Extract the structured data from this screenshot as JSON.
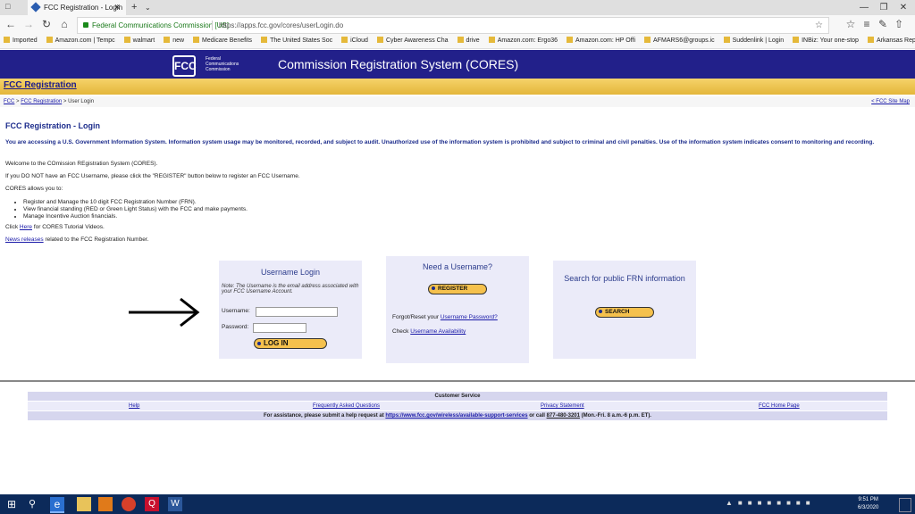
{
  "browser": {
    "tab_title": "FCC Registration - Login",
    "site_identity": "Federal Communications Commission [US]",
    "url": "https://apps.fcc.gov/cores/userLogin.do",
    "bookmarks": [
      "Imported",
      "Amazon.com | Tempc",
      "walmart",
      "new",
      "Medicare Benefits",
      "The United States Soc",
      "iCloud",
      "Cyber Awareness Cha",
      "drive",
      "Amazon.com: Ergo36",
      "Amazon.com: HP Offi",
      "AFMARS6@groups.ic",
      "Suddenlink | Login",
      "INBiz: Your one-stop",
      "Arkansas Repeater Co"
    ]
  },
  "header": {
    "logo_text": "FCC",
    "logo_subtitle": "Federal Communications Commission",
    "system_title": "Commission Registration System (CORES)",
    "registration_link": "FCC Registration",
    "breadcrumb": {
      "fcc": "FCC",
      "sep1": ">",
      "reg": "FCC Registration",
      "sep2": ">",
      "current": "User Login"
    },
    "site_map": "< FCC Site Map"
  },
  "content": {
    "title": "FCC Registration - Login",
    "warning": "You are accessing a U.S. Government Information System. Information system usage may be monitored, recorded, and subject to audit. Unauthorized use of the information system is prohibited and subject to criminal and civil penalties. Use of the information system indicates consent to monitoring and recording.",
    "welcome": "Welcome to the COmission REgistration System (CORES).",
    "no_username": "If you DO NOT have an FCC Username, please click the \"REGISTER\" button below to register an FCC Username.",
    "allows": "CORES allows you to:",
    "list": [
      "Register and Manage the 10 digit FCC Registration Number (FRN).",
      "View financial standing (RED or Green Light Status) with the FCC and make payments.",
      "Manage Incentive Auction financials."
    ],
    "tutorial_prefix": "Click",
    "tutorial_link": "Here",
    "tutorial_suffix": "for CORES Tutorial Videos.",
    "news_link": "News releases",
    "news_suffix": "related to the FCC Registration Number."
  },
  "login_box": {
    "title": "Username Login",
    "note": "Note: The Username is the email address associated with your FCC Username Account.",
    "username_label": "Username:",
    "username_value": "",
    "password_label": "Password:",
    "password_value": "",
    "login_button": "LOG IN"
  },
  "register_box": {
    "title": "Need a Username?",
    "register_button": "REGISTER",
    "forgot_prefix": "Forgot/Reset your",
    "forgot_link": "Username Password?",
    "check_prefix": "Check",
    "check_link": "Username Availability"
  },
  "search_box": {
    "title": "Search for public FRN information",
    "search_button": "SEARCH"
  },
  "footer": {
    "title": "Customer Service",
    "links": [
      "Help",
      "Frequently Asked Questions",
      "Privacy Statement",
      "FCC Home Page"
    ],
    "assist_prefix": "For assistance, please submit a help request at",
    "assist_link": "https://www.fcc.gov/wireless/available-support-services",
    "assist_mid": "or call",
    "phone": "877-480-3201",
    "assist_suffix": "(Mon.-Fri. 8 a.m.-6 p.m. ET)."
  },
  "taskbar": {
    "time": "9:51 PM",
    "date": "6/3/2020"
  },
  "colors": {
    "header_blue": "#22208a",
    "gold": "#f5c14d",
    "link_blue": "#1a1aa8",
    "box_bg": "#ebebf9"
  }
}
